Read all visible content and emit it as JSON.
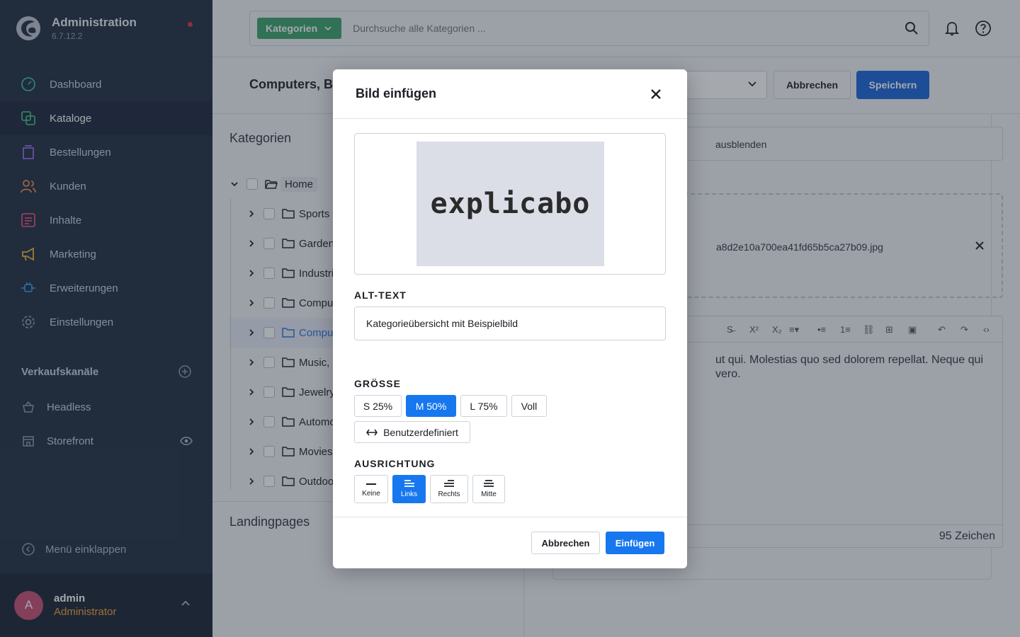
{
  "app": {
    "title": "Administration",
    "version": "6.7.12.2"
  },
  "sidebar": {
    "items": [
      {
        "label": "Dashboard",
        "icon": "dashboard-icon",
        "color": "#2fb8b0"
      },
      {
        "label": "Kataloge",
        "icon": "catalog-icon",
        "color": "#3cba7c"
      },
      {
        "label": "Bestellungen",
        "icon": "bag-icon",
        "color": "#8e6cf0"
      },
      {
        "label": "Kunden",
        "icon": "users-icon",
        "color": "#f08a4b"
      },
      {
        "label": "Inhalte",
        "icon": "content-icon",
        "color": "#e4497c"
      },
      {
        "label": "Marketing",
        "icon": "megaphone-icon",
        "color": "#f2b52c"
      },
      {
        "label": "Erweiterungen",
        "icon": "plug-icon",
        "color": "#2e95e8"
      },
      {
        "label": "Einstellungen",
        "icon": "gear-icon",
        "color": "#8a96a8"
      }
    ],
    "active_item": "Kataloge",
    "sales_channels_heading": "Verkaufskanäle",
    "sales_channels": [
      {
        "label": "Headless",
        "icon": "basket-icon"
      },
      {
        "label": "Storefront",
        "icon": "storefront-icon"
      }
    ],
    "collapse_label": "Menü einklappen",
    "user": {
      "initial": "A",
      "name": "admin",
      "role": "Administrator"
    }
  },
  "topbar": {
    "search_type": "Kategorien",
    "search_placeholder": "Durchsuche alle Kategorien ..."
  },
  "page": {
    "title": "Computers, B",
    "cancel_label": "Abbrechen",
    "save_label": "Speichern"
  },
  "tree": {
    "title": "Kategorien",
    "root": "Home",
    "items": [
      {
        "label": "Sports &",
        "selected": false
      },
      {
        "label": "Garden",
        "selected": false
      },
      {
        "label": "Industria",
        "selected": false
      },
      {
        "label": "Compute",
        "selected": false
      },
      {
        "label": "Compute",
        "selected": true
      },
      {
        "label": "Music, O",
        "selected": false
      },
      {
        "label": "Jewelry,",
        "selected": false
      },
      {
        "label": "Automoti",
        "selected": false
      },
      {
        "label": "Movies, C",
        "selected": false
      },
      {
        "label": "Outdoors",
        "selected": false
      }
    ],
    "landing_title": "Landingpages"
  },
  "content": {
    "hide_field_text": "ausblenden",
    "file_name": "a8d2e10a700ea41fd65b5ca27b09.jpg",
    "editor_text": "ut qui. Molestias quo sed dolorem repellat. Neque qui vero.",
    "char_count": "95 Zeichen"
  },
  "modal": {
    "title": "Bild einfügen",
    "preview_text": "explicabo",
    "alt_label": "ALT-TEXT",
    "alt_value": "Kategorieübersicht mit Beispielbild",
    "size_label": "GRÖSSE",
    "sizes": [
      {
        "label": "S 25%",
        "active": false
      },
      {
        "label": "M 50%",
        "active": true
      },
      {
        "label": "L 75%",
        "active": false
      },
      {
        "label": "Voll",
        "active": false
      }
    ],
    "custom_label": "Benutzerdefiniert",
    "align_label": "AUSRICHTUNG",
    "alignments": [
      {
        "label": "Keine",
        "active": false
      },
      {
        "label": "Links",
        "active": true
      },
      {
        "label": "Rechts",
        "active": false
      },
      {
        "label": "Mitte",
        "active": false
      }
    ],
    "cancel_label": "Abbrechen",
    "insert_label": "Einfügen"
  }
}
